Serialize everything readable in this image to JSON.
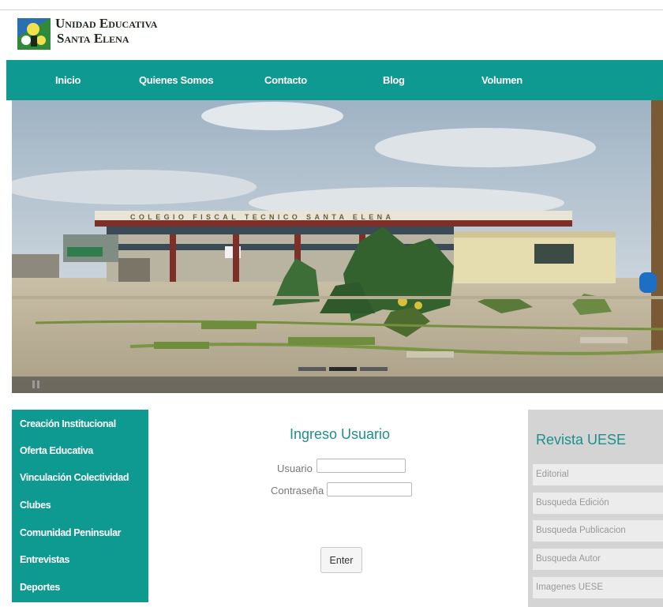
{
  "header": {
    "logo_line1": "Unidad Educativa",
    "logo_line2": "Santa Elena"
  },
  "nav": {
    "items": [
      {
        "label": "Inicio"
      },
      {
        "label": "Quienes Somos"
      },
      {
        "label": "Contacto"
      },
      {
        "label": "Blog"
      },
      {
        "label": "Volumen"
      }
    ]
  },
  "banner": {
    "building_sign": "COLEGIO FISCAL TECNICO SANTA ELENA",
    "slides": 3,
    "active_slide": 2
  },
  "left_menu": {
    "items": [
      {
        "label": "Creación Institucional"
      },
      {
        "label": "Oferta Educativa"
      },
      {
        "label": "Vinculación Colectividad"
      },
      {
        "label": "Clubes"
      },
      {
        "label": "Comunidad Peninsular"
      },
      {
        "label": "Entrevistas"
      },
      {
        "label": "Deportes"
      }
    ]
  },
  "login": {
    "title": "Ingreso Usuario",
    "user_label": "Usuario",
    "user_value": "",
    "password_label": "Contraseña",
    "password_value": "",
    "submit_label": "Enter"
  },
  "revista": {
    "title": "Revista UESE",
    "items": [
      {
        "label": "Editorial"
      },
      {
        "label": "Busqueda Edición"
      },
      {
        "label": "Busqueda Publicacion"
      },
      {
        "label": "Busqueda Autor"
      },
      {
        "label": "Imagenes UESE"
      }
    ]
  },
  "colors": {
    "teal": "#0f9a91",
    "title_teal": "#1e8f8a",
    "side_gray": "#d4d4d4"
  }
}
